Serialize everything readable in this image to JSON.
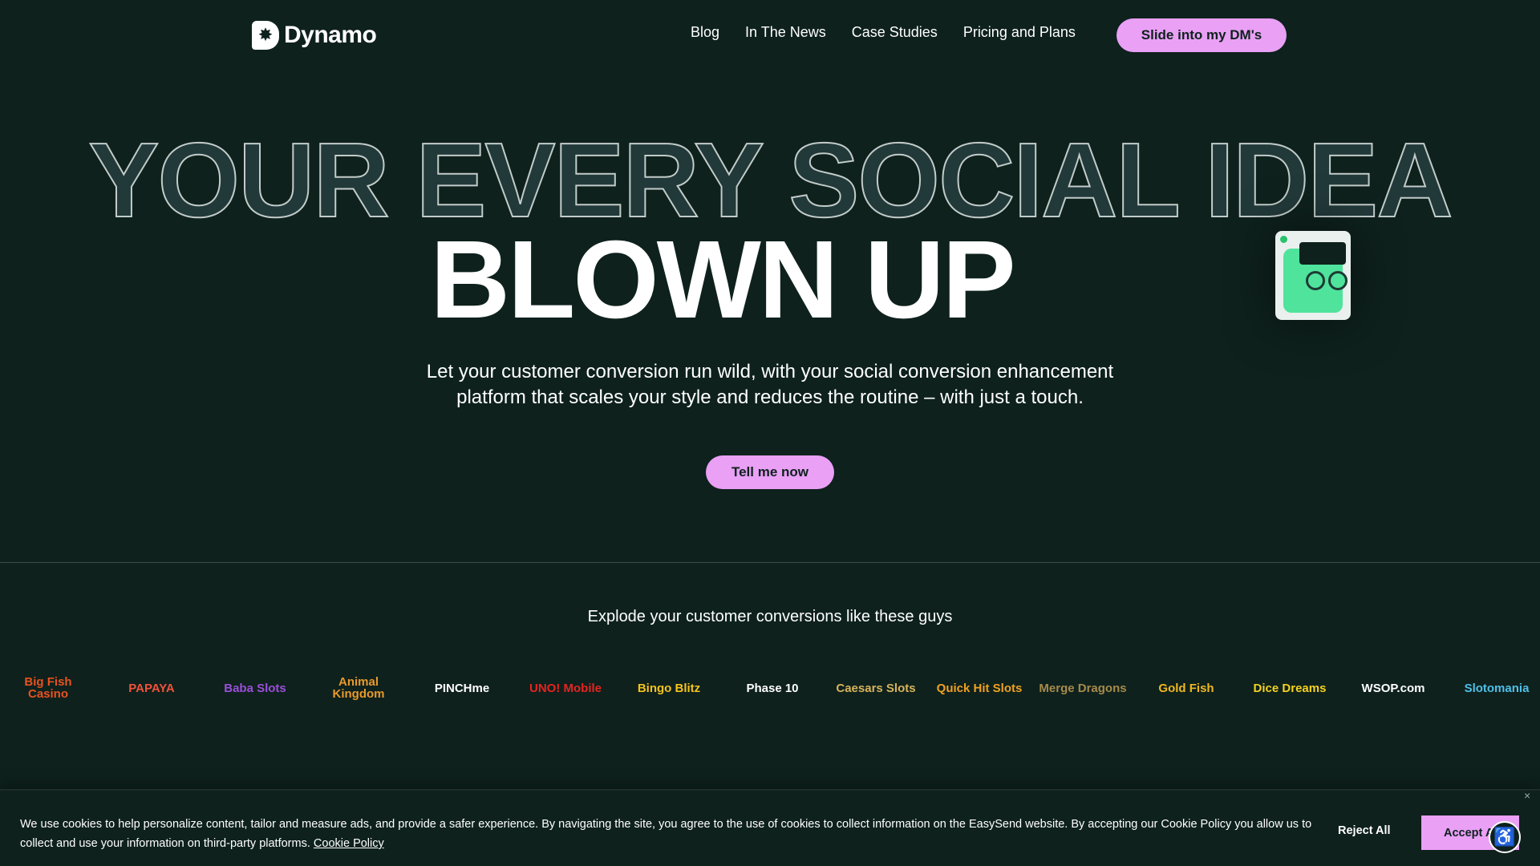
{
  "brand": {
    "name": "Dynamo"
  },
  "nav": {
    "items": [
      "Blog",
      "In The News",
      "Case Studies",
      "Pricing and Plans"
    ],
    "cta": "Slide into my DM's"
  },
  "hero": {
    "line1": "YOUR EVERY SOCIAL IDEA",
    "line2": "BLOWN UP",
    "subtitle_1": "Let your customer conversion run wild, with your social conversion enhancement",
    "subtitle_2": "platform that scales your style and reduces the routine – with just a touch.",
    "cta": "Tell me now"
  },
  "clients": {
    "heading": "Explode your customer conversions like these guys",
    "logos": [
      {
        "name": "Big Fish Casino",
        "color": "#e8521f"
      },
      {
        "name": "PAPAYA",
        "color": "#f0523a"
      },
      {
        "name": "Baba Slots",
        "color": "#9a4fd8"
      },
      {
        "name": "Animal Kingdom",
        "color": "#e89a2a"
      },
      {
        "name": "PINCHme",
        "color": "#ffffff"
      },
      {
        "name": "UNO! Mobile",
        "color": "#e8231f"
      },
      {
        "name": "Bingo Blitz",
        "color": "#f5c21f"
      },
      {
        "name": "Phase 10",
        "color": "#ffffff"
      },
      {
        "name": "Caesars Slots",
        "color": "#d8b35a"
      },
      {
        "name": "Quick Hit Slots",
        "color": "#f0a11f"
      },
      {
        "name": "Merge Dragons",
        "color": "#a68a4a"
      },
      {
        "name": "Gold Fish",
        "color": "#f0b81f"
      },
      {
        "name": "Dice Dreams",
        "color": "#f5d21f"
      },
      {
        "name": "WSOP.com",
        "color": "#ffffff"
      },
      {
        "name": "Slotomania",
        "color": "#4fc0e8"
      }
    ]
  },
  "cookie": {
    "text": "We use cookies to help personalize content, tailor and measure ads, and provide a safer experience. By navigating the site, you agree to the use of cookies to collect information on the EasySend website. By accepting our Cookie Policy you allow us to collect and use your information on third-party platforms.",
    "link": "Cookie Policy",
    "reject": "Reject All",
    "accept": "Accept All",
    "close": "×"
  },
  "colors": {
    "background": "#0e211d",
    "accent": "#e9a0f5"
  }
}
